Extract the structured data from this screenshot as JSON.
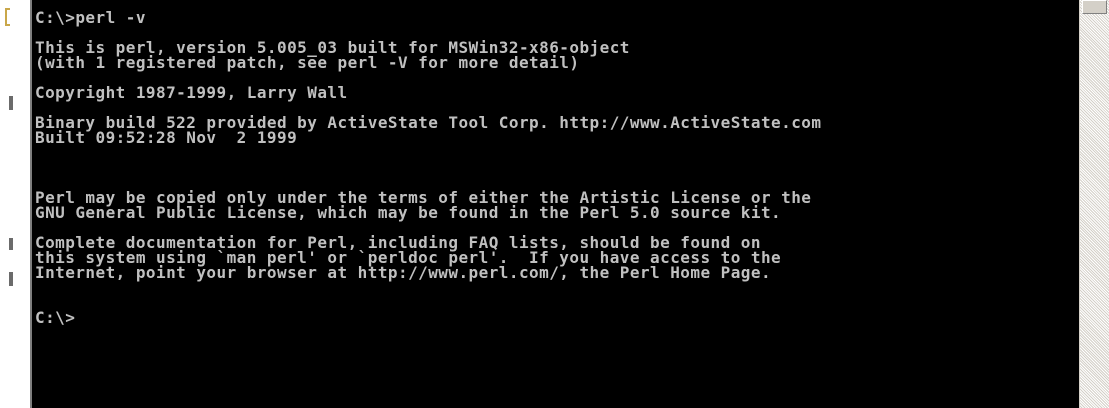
{
  "console": {
    "lines": [
      "C:\\>perl -v",
      "",
      "This is perl, version 5.005_03 built for MSWin32-x86-object",
      "(with 1 registered patch, see perl -V for more detail)",
      "",
      "Copyright 1987-1999, Larry Wall",
      "",
      "Binary build 522 provided by ActiveState Tool Corp. http://www.ActiveState.com",
      "Built 09:52:28 Nov  2 1999",
      "",
      "",
      "",
      "Perl may be copied only under the terms of either the Artistic License or the",
      "GNU General Public License, which may be found in the Perl 5.0 source kit.",
      "",
      "Complete documentation for Perl, including FAQ lists, should be found on",
      "this system using `man perl' or `perldoc perl'.  If you have access to the",
      "Internet, point your browser at http://www.perl.com/, the Perl Home Page.",
      "",
      "",
      "C:\\>"
    ],
    "colors": {
      "background": "#000000",
      "text": "#c0c0c0"
    }
  },
  "scrollbar": {
    "colors": {
      "track": "#ece9d8",
      "thumb": "#d4d0c8"
    }
  }
}
